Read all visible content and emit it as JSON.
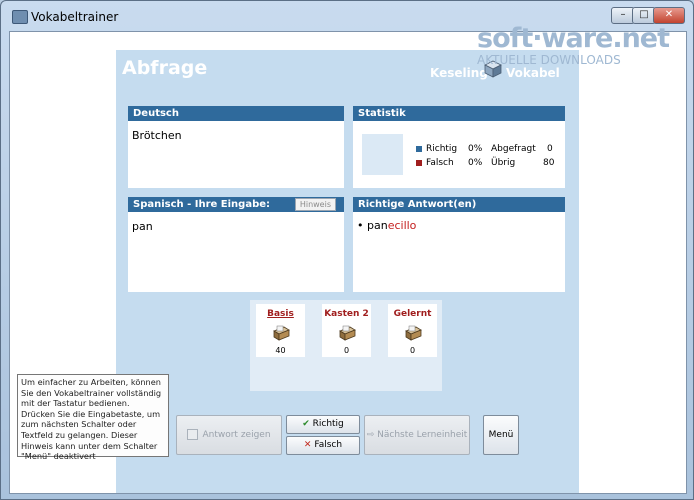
{
  "window": {
    "title": "Vokabeltrainer",
    "minimize": "–",
    "maximize": "□",
    "close": "✕"
  },
  "watermark": {
    "main": "soft·ware.net",
    "sub": "AKTUELLE DOWNLOADS"
  },
  "panel": {
    "heading": "Abfrage",
    "brand": "Keseling",
    "brand_suffix": "Vokabel"
  },
  "deutsch": {
    "header": "Deutsch",
    "word": "Brötchen"
  },
  "statistik": {
    "header": "Statistik",
    "rows": [
      {
        "label": "Richtig",
        "percent": "0%",
        "label2": "Abgefragt",
        "value2": "0",
        "color": "#2f6a9c"
      },
      {
        "label": "Falsch",
        "percent": "0%",
        "label2": "Übrig",
        "value2": "80",
        "color": "#a01e1e"
      }
    ]
  },
  "eingabe": {
    "header": "Spanisch - Ihre Eingabe:",
    "hint_button": "Hinweis",
    "value": "pan"
  },
  "antwort": {
    "header": "Richtige Antwort(en)",
    "bullet": "•",
    "match": "pan",
    "rest": "ecillo"
  },
  "kasten": [
    {
      "label": "Basis",
      "count": "40"
    },
    {
      "label": "Kasten 2",
      "count": "0"
    },
    {
      "label": "Gelernt",
      "count": "0"
    }
  ],
  "tooltip": "Um einfacher zu Arbeiten, können Sie den Vokabeltrainer vollständig mit der Tastatur bedienen. Drücken Sie die Eingabetaste, um zum nächsten Schalter oder Textfeld zu gelangen. Dieser Hinweis kann unter dem Schalter \"Menü\" deaktivert",
  "buttons": {
    "antwort_zeigen": "Antwort zeigen",
    "richtig": "Richtig",
    "falsch": "Falsch",
    "naechste": "Nächste Lerneinheit",
    "menu": "Menü"
  }
}
